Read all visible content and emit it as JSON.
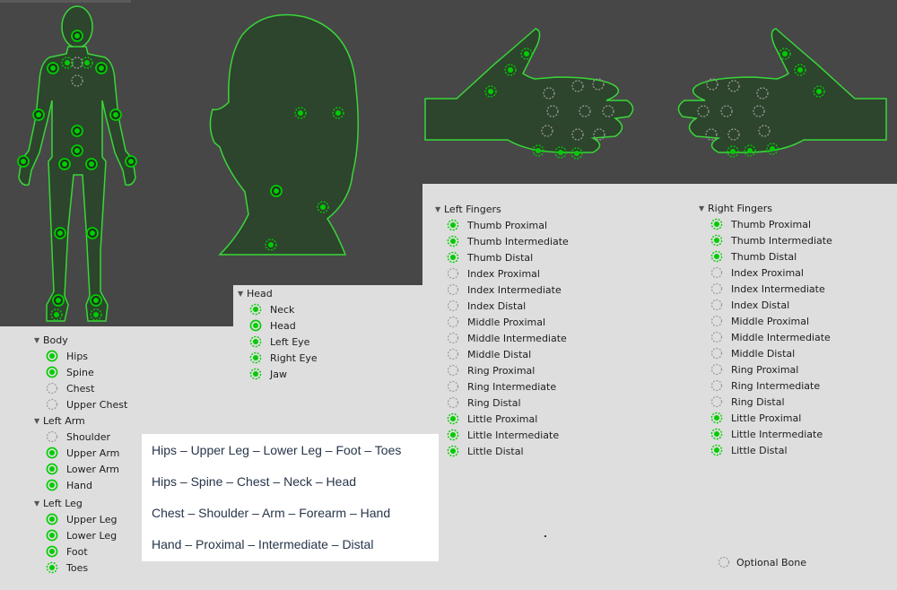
{
  "colors": {
    "accent": "#00cc00",
    "optional": "#9a9a9a",
    "panel_bg": "#474747",
    "figure_fill": "#2d442d"
  },
  "body": {
    "title": "Body",
    "bones": [
      {
        "label": "Hips",
        "type": "required"
      },
      {
        "label": "Spine",
        "type": "required"
      },
      {
        "label": "Chest",
        "type": "optional"
      },
      {
        "label": "Upper Chest",
        "type": "optional"
      }
    ]
  },
  "left_arm": {
    "title": "Left Arm",
    "bones": [
      {
        "label": "Shoulder",
        "type": "optional"
      },
      {
        "label": "Upper Arm",
        "type": "required"
      },
      {
        "label": "Lower Arm",
        "type": "required"
      },
      {
        "label": "Hand",
        "type": "required"
      }
    ]
  },
  "left_leg": {
    "title": "Left Leg",
    "bones": [
      {
        "label": "Upper Leg",
        "type": "required"
      },
      {
        "label": "Lower Leg",
        "type": "required"
      },
      {
        "label": "Foot",
        "type": "required"
      },
      {
        "label": "Toes",
        "type": "mapped-optional"
      }
    ]
  },
  "head": {
    "title": "Head",
    "bones": [
      {
        "label": "Neck",
        "type": "mapped-optional"
      },
      {
        "label": "Head",
        "type": "required"
      },
      {
        "label": "Left Eye",
        "type": "mapped-optional"
      },
      {
        "label": "Right Eye",
        "type": "mapped-optional"
      },
      {
        "label": "Jaw",
        "type": "mapped-optional"
      }
    ]
  },
  "left_fingers": {
    "title": "Left Fingers",
    "bones": [
      {
        "label": "Thumb Proximal",
        "type": "mapped-optional"
      },
      {
        "label": "Thumb Intermediate",
        "type": "mapped-optional"
      },
      {
        "label": "Thumb Distal",
        "type": "mapped-optional"
      },
      {
        "label": "Index Proximal",
        "type": "optional"
      },
      {
        "label": "Index Intermediate",
        "type": "optional"
      },
      {
        "label": "Index Distal",
        "type": "optional"
      },
      {
        "label": "Middle Proximal",
        "type": "optional"
      },
      {
        "label": "Middle Intermediate",
        "type": "optional"
      },
      {
        "label": "Middle Distal",
        "type": "optional"
      },
      {
        "label": "Ring Proximal",
        "type": "optional"
      },
      {
        "label": "Ring Intermediate",
        "type": "optional"
      },
      {
        "label": "Ring Distal",
        "type": "optional"
      },
      {
        "label": "Little Proximal",
        "type": "mapped-optional"
      },
      {
        "label": "Little Intermediate",
        "type": "mapped-optional"
      },
      {
        "label": "Little Distal",
        "type": "mapped-optional"
      }
    ]
  },
  "right_fingers": {
    "title": "Right Fingers",
    "bones": [
      {
        "label": "Thumb Proximal",
        "type": "mapped-optional"
      },
      {
        "label": "Thumb Intermediate",
        "type": "mapped-optional"
      },
      {
        "label": "Thumb Distal",
        "type": "mapped-optional"
      },
      {
        "label": "Index Proximal",
        "type": "optional"
      },
      {
        "label": "Index Intermediate",
        "type": "optional"
      },
      {
        "label": "Index Distal",
        "type": "optional"
      },
      {
        "label": "Middle Proximal",
        "type": "optional"
      },
      {
        "label": "Middle Intermediate",
        "type": "optional"
      },
      {
        "label": "Middle Distal",
        "type": "optional"
      },
      {
        "label": "Ring Proximal",
        "type": "optional"
      },
      {
        "label": "Ring Intermediate",
        "type": "optional"
      },
      {
        "label": "Ring Distal",
        "type": "optional"
      },
      {
        "label": "Little Proximal",
        "type": "mapped-optional"
      },
      {
        "label": "Little Intermediate",
        "type": "mapped-optional"
      },
      {
        "label": "Little Distal",
        "type": "mapped-optional"
      }
    ]
  },
  "hierarchy_legend": {
    "lines": [
      "Hips – Upper Leg – Lower Leg – Foot – Toes",
      "Hips – Spine – Chest – Neck – Head",
      "Chest – Shoulder – Arm – Forearm – Hand",
      "Hand – Proximal – Intermediate – Distal"
    ]
  },
  "optional_legend": {
    "label": "Optional Bone"
  }
}
